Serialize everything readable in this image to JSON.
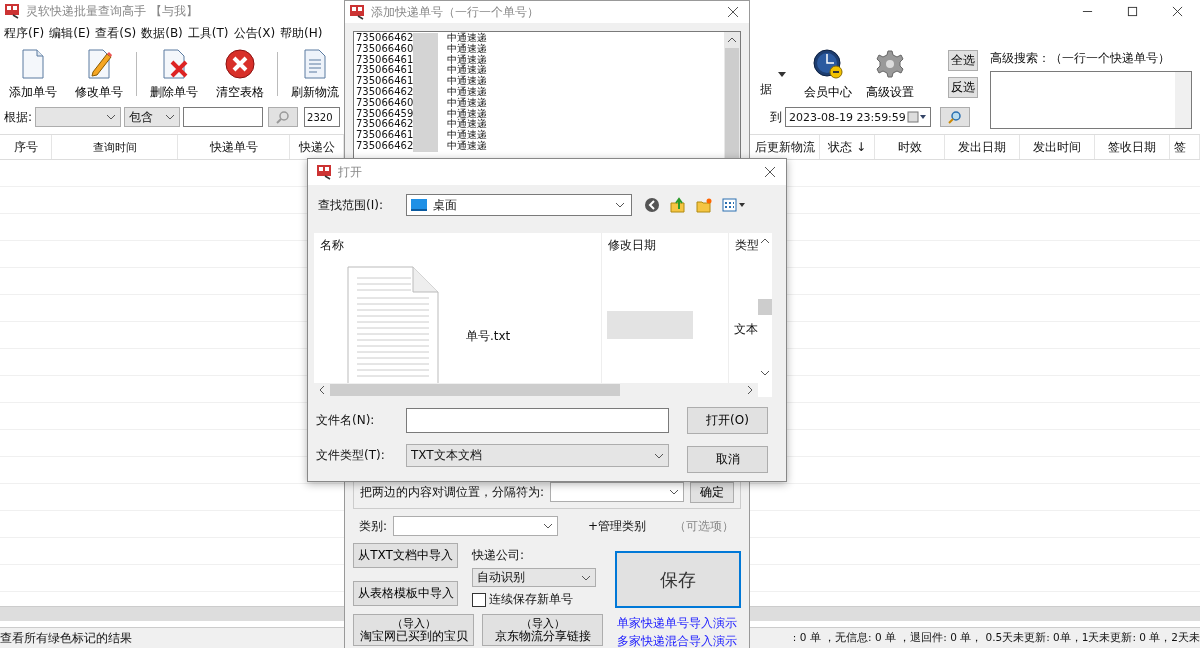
{
  "main_window": {
    "title": "灵软快递批量查询高手 【与我】",
    "menu": [
      "程序(F)",
      "编辑(E)",
      "查看(S)",
      "数据(B)",
      "工具(T)",
      "公告(X)",
      "帮助(H)"
    ],
    "toolbar": [
      {
        "label": "添加单号",
        "kind": "new"
      },
      {
        "label": "修改单号",
        "kind": "edit"
      },
      {
        "label": "删除单号",
        "kind": "delete"
      },
      {
        "label": "清空表格",
        "kind": "clear"
      },
      {
        "label": "刷新物流",
        "kind": "refresh"
      }
    ],
    "toolbar_right": [
      {
        "label": "据",
        "kind": "partial"
      },
      {
        "label": "会员中心",
        "kind": "clock"
      },
      {
        "label": "高级设置",
        "kind": "gear"
      }
    ],
    "selection_buttons": [
      "全选",
      "反选"
    ],
    "advanced_search_label": "高级搜索：（一行一个快递单号）",
    "filter": {
      "label": "根据:",
      "match": "包含",
      "date_from": "2320",
      "to_label": "到",
      "date_to": "2023-08-19 23:59:59"
    },
    "columns_left": [
      "序号",
      "查询时间",
      "快递单号",
      "快递公"
    ],
    "columns_right": [
      "后更新物流",
      "状态 ↓",
      "时效",
      "发出日期",
      "发出时间",
      "签收日期",
      "签"
    ],
    "status_left": "查看所有绿色标记的结果",
    "status_right": ": 0 单 ，无信息: 0 单 ，退回件: 0 单， 0.5天未更新: 0单，1天未更新: 0 单，2天未"
  },
  "add_dialog": {
    "title": "添加快递单号（一行一个单号）",
    "entries": [
      {
        "number": "735066462",
        "company": "中通速递"
      },
      {
        "number": "735066460",
        "company": "中通速递"
      },
      {
        "number": "735066461",
        "company": "中通速递"
      },
      {
        "number": "735066461",
        "company": "中通速递"
      },
      {
        "number": "735066461",
        "company": "中通速递"
      },
      {
        "number": "735066462",
        "company": "中通速递"
      },
      {
        "number": "735066460",
        "company": "中通速递"
      },
      {
        "number": "735066459",
        "company": "中通速递"
      },
      {
        "number": "735066462",
        "company": "中通速递"
      },
      {
        "number": "735066461",
        "company": "中通速递"
      },
      {
        "number": "735066462",
        "company": "中通速递"
      }
    ],
    "swap_label": "把两边的内容对调位置，分隔符为:",
    "confirm": "确定",
    "category_label": "类别:",
    "manage_category": "+管理类别",
    "optional": "（可选项）",
    "import_buttons": [
      "从TXT文档中导入",
      "从表格模板中导入"
    ],
    "company_label": "快递公司:",
    "company": "自动识别",
    "keep_saving": {
      "label": "连续保存新单号",
      "checked": false
    },
    "save": "保存",
    "import_links": [
      {
        "line1": "（导入）",
        "line2": "淘宝网已买到的宝贝"
      },
      {
        "line1": "（导入）",
        "line2": "京东物流分享链接"
      }
    ],
    "demo_links": [
      "单家快递单号导入演示",
      "多家快递混合导入演示"
    ]
  },
  "open_dialog": {
    "title": "打开",
    "look_in_label": "查找范围(I):",
    "look_in": "桌面",
    "columns": [
      "名称",
      "修改日期",
      "类型"
    ],
    "files": [
      {
        "name": "单号.txt",
        "type": "文本"
      }
    ],
    "file_name_label": "文件名(N):",
    "file_type_label": "文件类型(T):",
    "file_type": "TXT文本文档",
    "open": "打开(O)",
    "cancel": "取消"
  }
}
